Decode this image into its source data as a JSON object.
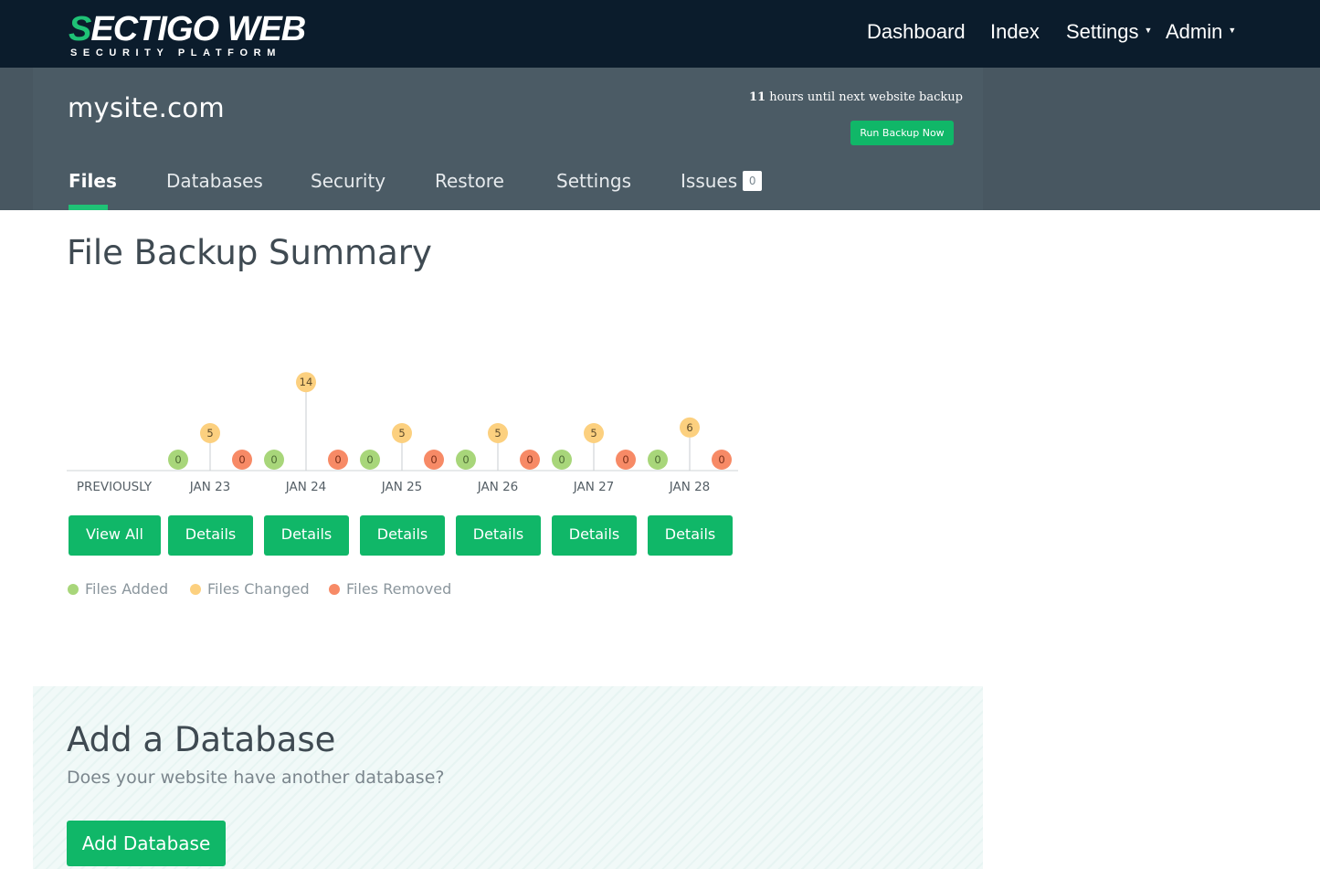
{
  "brand": {
    "logo_main_s": "S",
    "logo_main_rest": "ECTIGO WEB",
    "logo_sub": "SECURITY PLATFORM"
  },
  "top_nav": {
    "dashboard": "Dashboard",
    "index": "Index",
    "settings": "Settings",
    "admin": "Admin"
  },
  "site": {
    "name": "mysite.com",
    "hours_until_backup": "11",
    "backup_text": "hours until next website backup",
    "run_backup_label": "Run Backup Now"
  },
  "tabs": {
    "files": "Files",
    "databases": "Databases",
    "security": "Security",
    "restore": "Restore",
    "settings": "Settings",
    "issues": "Issues",
    "issues_count": "0",
    "active": "Files"
  },
  "summary": {
    "title": "File Backup Summary"
  },
  "chart_data": {
    "type": "scatter",
    "categories": [
      "PREVIOUSLY",
      "JAN 23",
      "JAN 24",
      "JAN 25",
      "JAN 26",
      "JAN 27",
      "JAN 28"
    ],
    "series": [
      {
        "name": "Files Added",
        "color": "#a8d67a",
        "values": [
          null,
          0,
          0,
          0,
          0,
          0,
          0
        ]
      },
      {
        "name": "Files Changed",
        "color": "#fcd07f",
        "values": [
          null,
          5,
          14,
          5,
          5,
          5,
          6
        ]
      },
      {
        "name": "Files Removed",
        "color": "#f78a66",
        "values": [
          null,
          0,
          0,
          0,
          0,
          0,
          0
        ]
      }
    ],
    "legend": "bottom-left"
  },
  "buttons": {
    "view_all": "View All",
    "details": "Details"
  },
  "legend": {
    "added": "Files Added",
    "changed": "Files Changed",
    "removed": "Files Removed"
  },
  "database": {
    "title": "Add a Database",
    "subtitle": "Does your website have another database?",
    "button": "Add Database"
  }
}
